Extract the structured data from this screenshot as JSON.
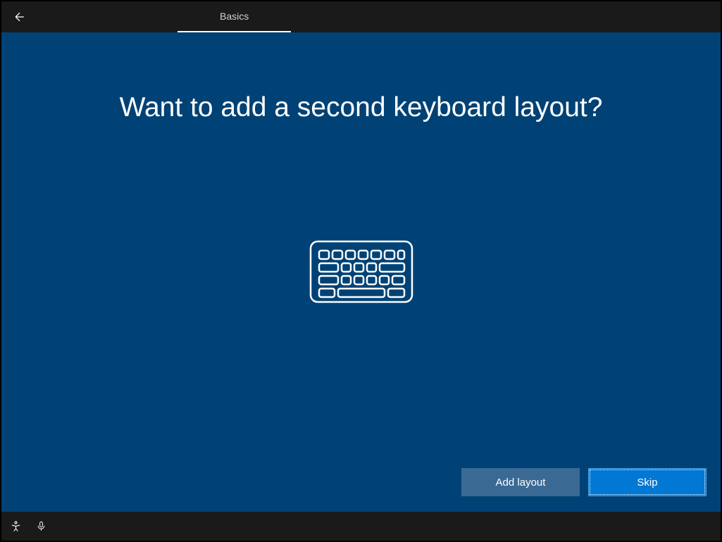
{
  "header": {
    "tab_label": "Basics"
  },
  "main": {
    "heading": "Want to add a second keyboard layout?"
  },
  "buttons": {
    "add_layout": "Add layout",
    "skip": "Skip"
  }
}
